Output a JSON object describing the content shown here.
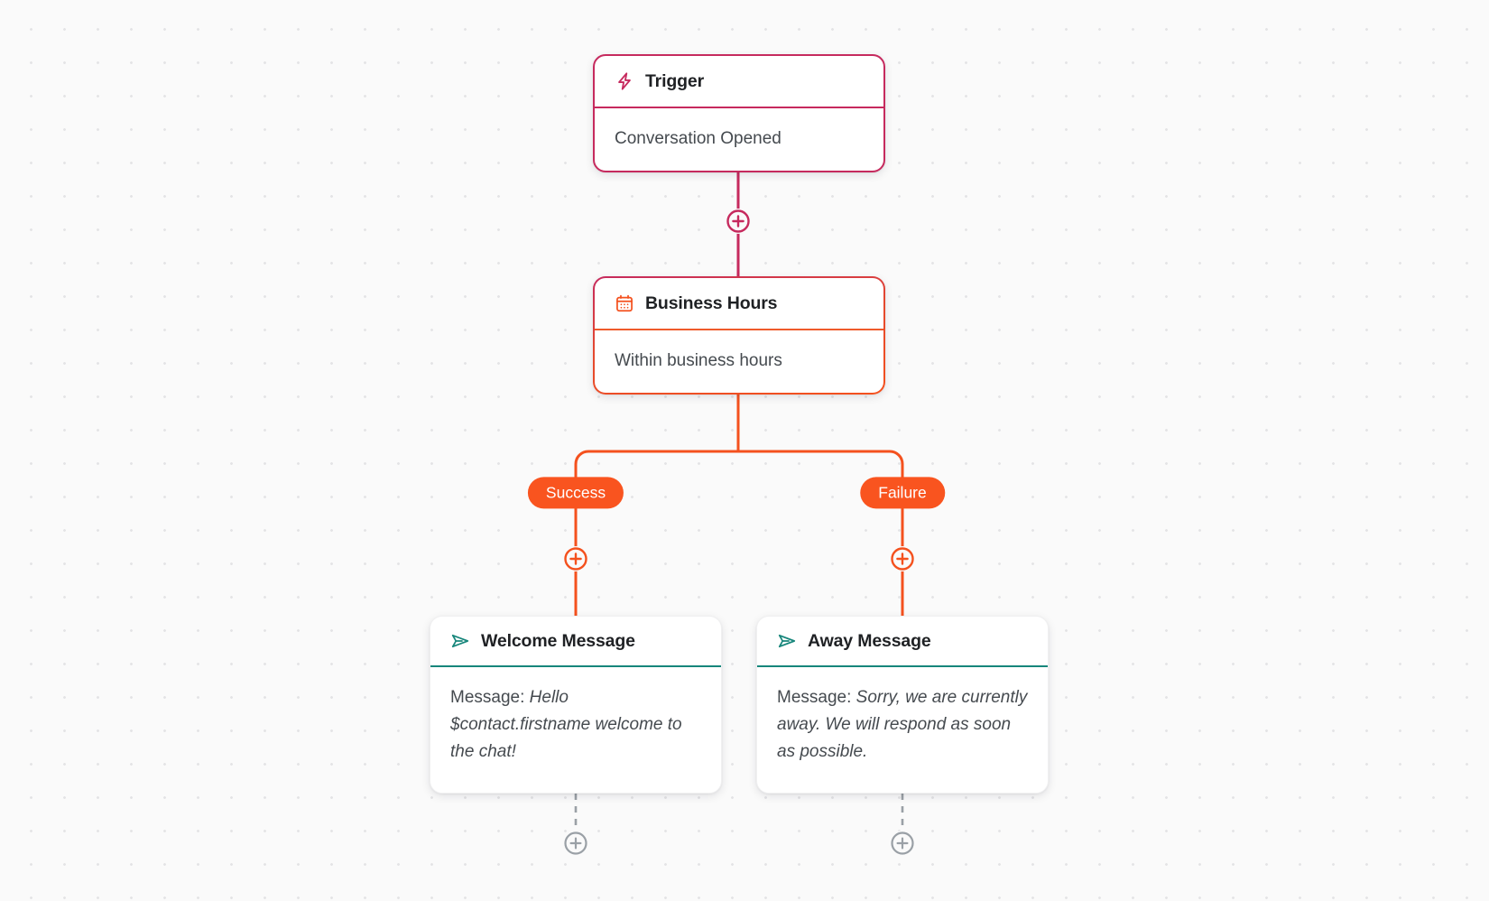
{
  "canvas": {
    "background": "#fafafa",
    "dot_color": "#e4e4e6"
  },
  "colors": {
    "trigger_accent": "#c62a5e",
    "condition_accent": "#f4511e",
    "branch_accent": "#f9541f",
    "message_accent": "#17867b",
    "inactive_accent": "#9aa0a6"
  },
  "nodes": [
    {
      "id": "trigger",
      "icon": "lightning-bolt-icon",
      "title": "Trigger",
      "body": "Conversation Opened"
    },
    {
      "id": "business-hours",
      "icon": "calendar-icon",
      "title": "Business Hours",
      "body": "Within business hours"
    },
    {
      "id": "welcome-message",
      "icon": "send-icon",
      "title": "Welcome Message",
      "body_label": "Message: ",
      "body_text": "Hello $contact.firstname welcome to the chat!"
    },
    {
      "id": "away-message",
      "icon": "send-icon",
      "title": "Away Message",
      "body_label": "Message: ",
      "body_text": "Sorry, we are currently away. We will respond as soon as possible."
    }
  ],
  "branches": [
    {
      "id": "success",
      "label": "Success"
    },
    {
      "id": "failure",
      "label": "Failure"
    }
  ],
  "add_buttons": [
    {
      "id": "plus-trigger",
      "icon": "plus-circle-icon",
      "state": "active-crimson"
    },
    {
      "id": "plus-success-branch",
      "icon": "plus-circle-icon",
      "state": "active-orange"
    },
    {
      "id": "plus-failure-branch",
      "icon": "plus-circle-icon",
      "state": "active-orange"
    },
    {
      "id": "plus-welcome-end",
      "icon": "plus-circle-icon",
      "state": "inactive-gray"
    },
    {
      "id": "plus-away-end",
      "icon": "plus-circle-icon",
      "state": "inactive-gray"
    }
  ]
}
